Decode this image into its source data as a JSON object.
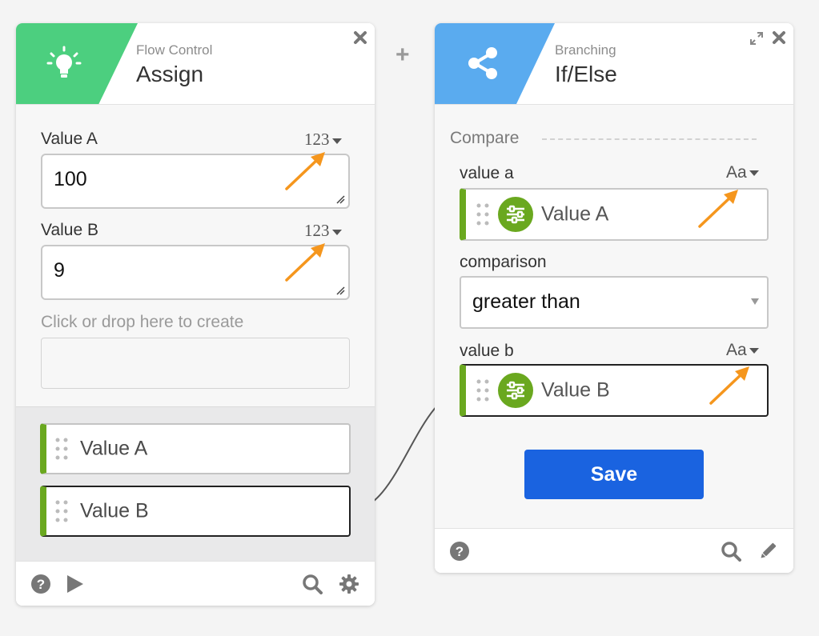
{
  "assign_card": {
    "subtitle": "Flow Control",
    "title": "Assign",
    "fields": [
      {
        "label": "Value A",
        "type_toggle": "123",
        "value": "100"
      },
      {
        "label": "Value B",
        "type_toggle": "123",
        "value": "9"
      }
    ],
    "create_placeholder": "Click or drop here to create",
    "variables": [
      {
        "label": "Value A",
        "selected": false
      },
      {
        "label": "Value B",
        "selected": true
      }
    ]
  },
  "ifelse_card": {
    "subtitle": "Branching",
    "title": "If/Else",
    "section_label": "Compare",
    "value_a": {
      "label": "value a",
      "type_toggle": "Aa",
      "ref": "Value A"
    },
    "comparison": {
      "label": "comparison",
      "selected": "greater than"
    },
    "value_b": {
      "label": "value b",
      "type_toggle": "Aa",
      "ref": "Value B"
    },
    "save_label": "Save"
  },
  "icons": {
    "assign_tile": "lightbulb-icon",
    "ifelse_tile": "share-icon",
    "close": "close-icon",
    "expand": "expand-icon",
    "help": "help-icon",
    "play": "play-icon",
    "search": "search-icon",
    "settings": "gear-icon",
    "edit": "pencil-icon",
    "add": "plus-icon",
    "annotation": "arrow-icon"
  },
  "colors": {
    "assign_accent": "#4ccf7f",
    "branching_accent": "#5aabef",
    "variable_green": "#6aa81f",
    "save_blue": "#1a63e0",
    "annotation_orange": "#f5961d"
  }
}
